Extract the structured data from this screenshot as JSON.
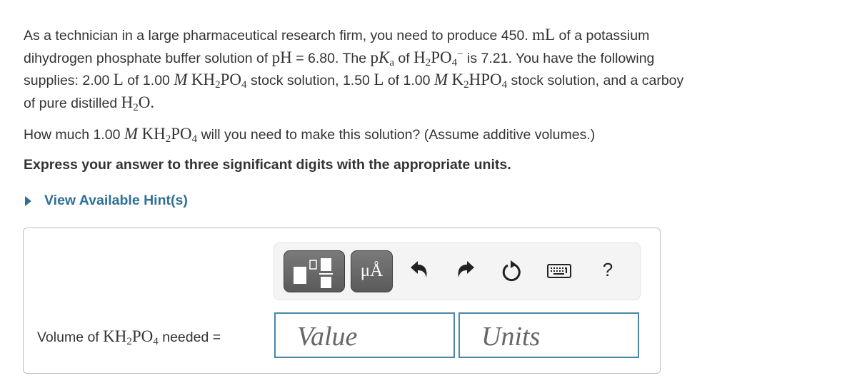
{
  "problem": {
    "line1_a": "As a technician in a large pharmaceutical research firm, you need to produce 450.",
    "line1_unit": "mL",
    "line1_b": "of a potassium",
    "line2_a": "dihydrogen phosphate buffer solution of",
    "ph_symbol": "pH",
    "line2_b": "= 6.80. The",
    "pka_p": "p",
    "pka_K": "K",
    "pka_sub": "a",
    "line2_c": "of",
    "ion_H": "H",
    "ion_H_sub": "2",
    "ion_PO": "PO",
    "ion_PO_sub": "4",
    "ion_charge": "−",
    "line2_d": "is 7.21. You have the following",
    "line3_a": "supplies: 2.00",
    "unit_L": "L",
    "line3_b": "of 1.00",
    "molar": "M",
    "kh2po4_K": "KH",
    "kh2po4_sub2": "2",
    "kh2po4_PO": "PO",
    "kh2po4_sub4": "4",
    "line3_c": "stock solution, 1.50",
    "line3_d": "of 1.00",
    "k2hpo4_K": "K",
    "k2hpo4_sub2": "2",
    "k2hpo4_HPO": "HPO",
    "k2hpo4_sub4": "4",
    "line3_e": "stock solution, and a carboy",
    "line4_a": "of pure distilled",
    "water_H": "H",
    "water_sub": "2",
    "water_O": "O."
  },
  "question": {
    "a": "How much 1.00",
    "molar": "M",
    "KH": "KH",
    "sub2": "2",
    "PO": "PO",
    "sub4": "4",
    "b": "will you need to make this solution? (Assume additive volumes.)"
  },
  "instruction": "Express your answer to three significant digits with the appropriate units.",
  "hint": {
    "label": "View Available Hint(s)",
    "icon": "triangle-right-icon",
    "color": "#2e7096"
  },
  "toolbar": {
    "units_button_label": "μÅ",
    "buttons": [
      "templates",
      "units",
      "undo",
      "redo",
      "reset",
      "keyboard",
      "help"
    ],
    "help_label": "?"
  },
  "answer": {
    "label_a": "Volume of",
    "KH": "KH",
    "sub2": "2",
    "PO": "PO",
    "sub4": "4",
    "label_b": "needed =",
    "value_placeholder": "Value",
    "units_placeholder": "Units",
    "field_border_color": "#4b86a6"
  }
}
